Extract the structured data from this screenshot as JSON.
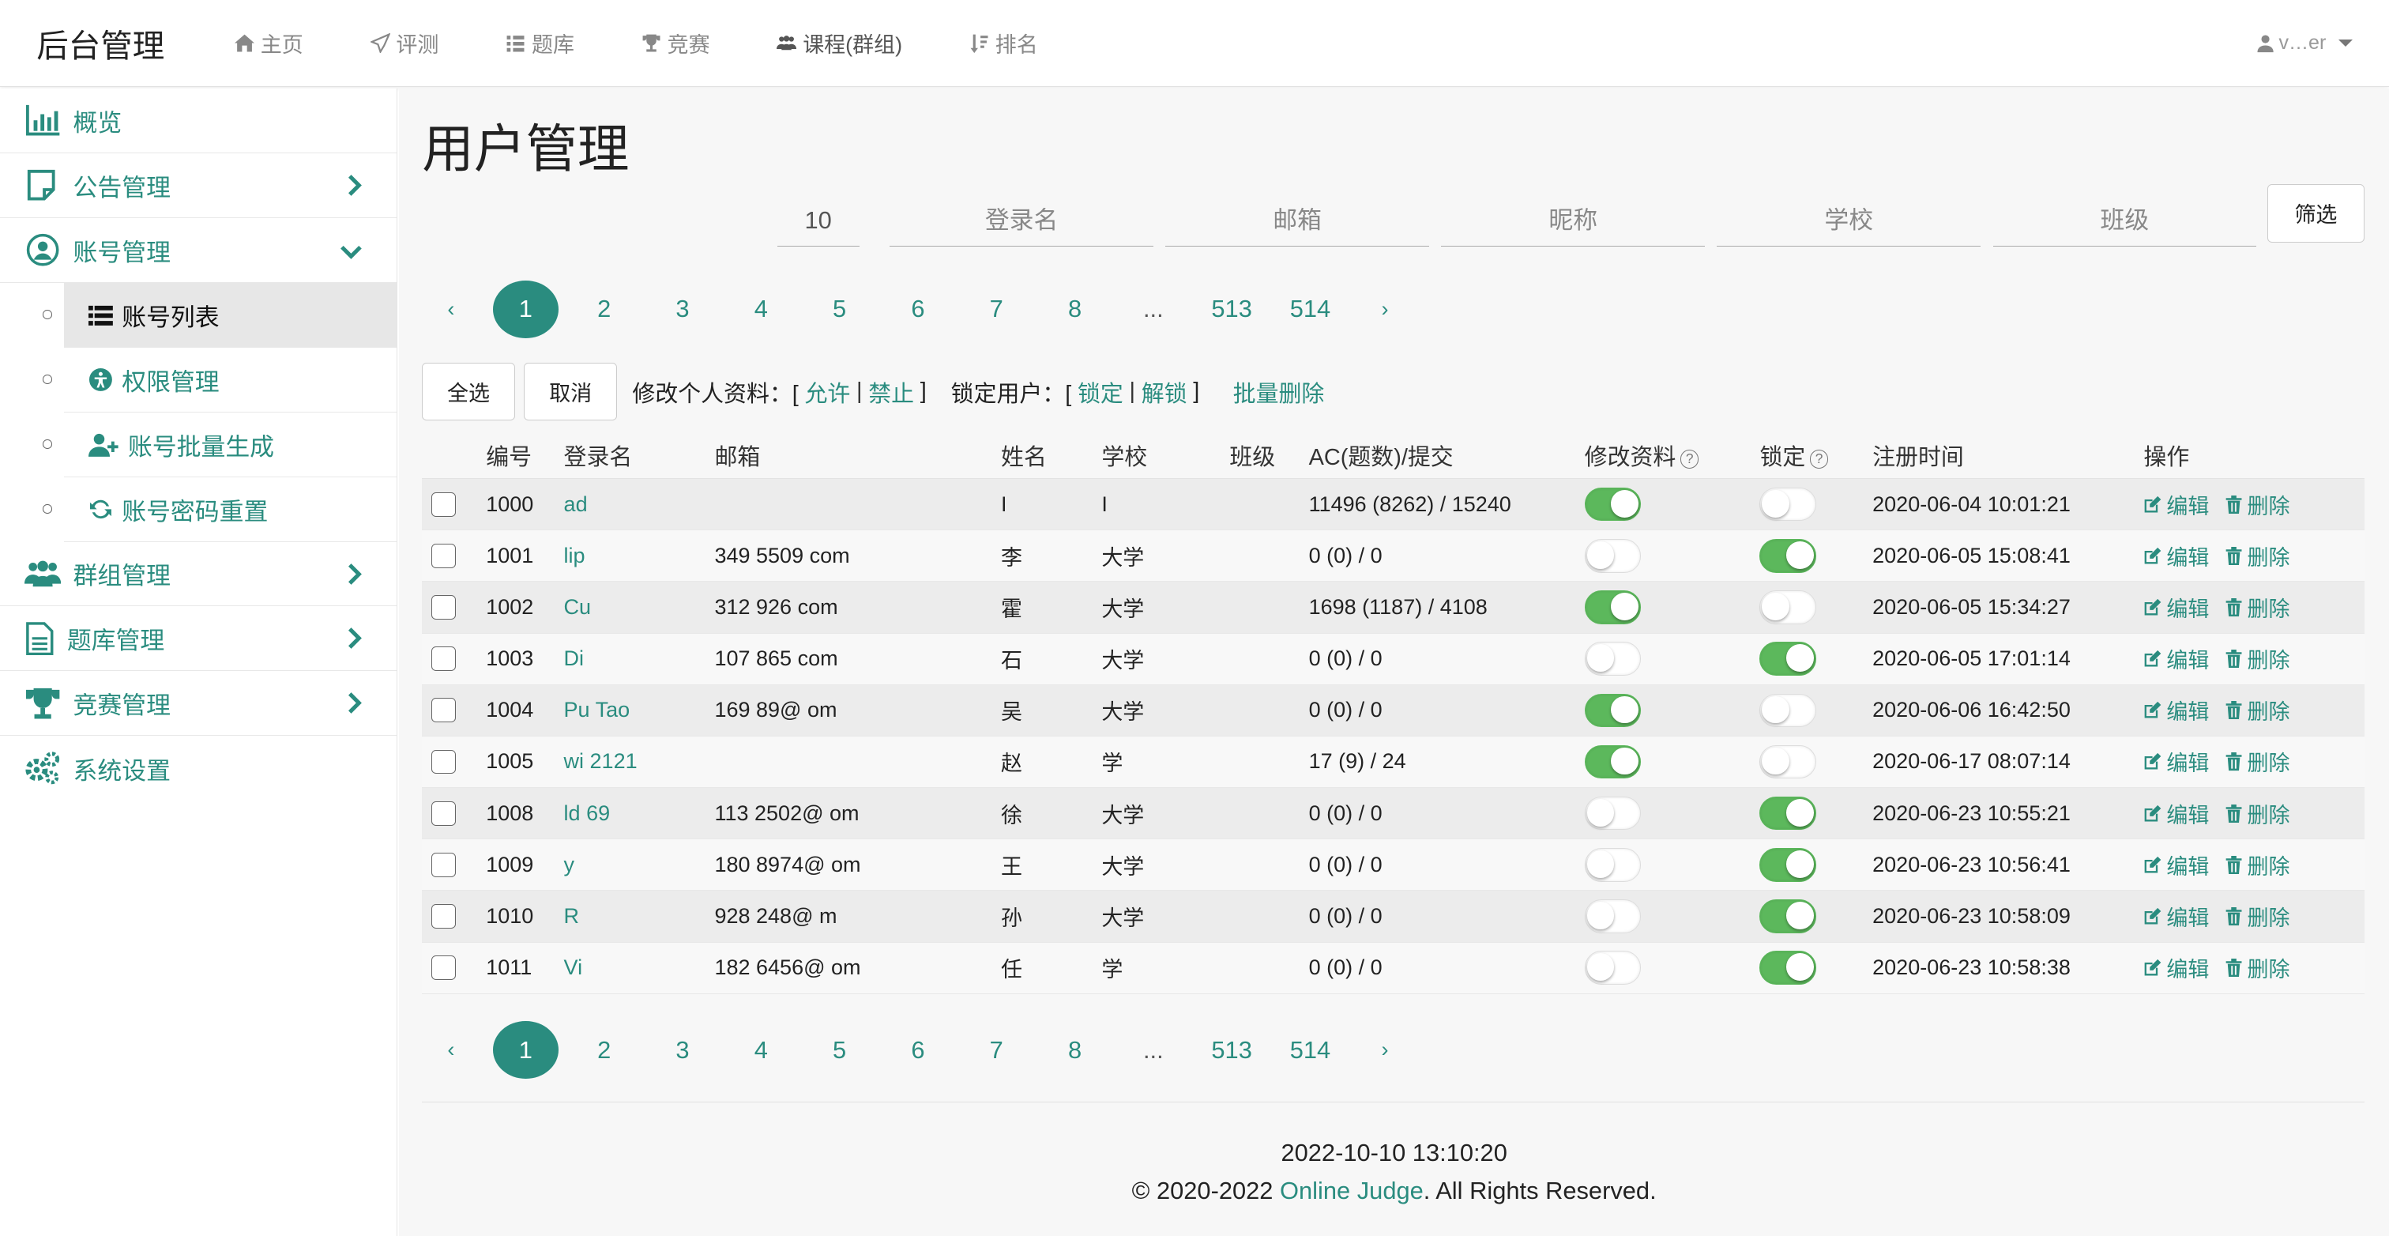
{
  "brand": "后台管理",
  "nav": [
    {
      "label": "主页",
      "icon": "home-icon"
    },
    {
      "label": "评测",
      "icon": "paper-plane-icon"
    },
    {
      "label": "题库",
      "icon": "list-icon"
    },
    {
      "label": "竞赛",
      "icon": "trophy-icon"
    },
    {
      "label": "课程(群组)",
      "icon": "users-icon"
    },
    {
      "label": "排名",
      "icon": "sort-icon"
    }
  ],
  "user_menu": {
    "icon": "user-icon",
    "name": "v…er"
  },
  "sidebar": {
    "overview": "概览",
    "notice": "公告管理",
    "account": "账号管理",
    "sub": {
      "list": "账号列表",
      "perm": "权限管理",
      "batch": "账号批量生成",
      "reset": "账号密码重置"
    },
    "group": "群组管理",
    "problem": "题库管理",
    "contest": "竞赛管理",
    "settings": "系统设置"
  },
  "page_title": "用户管理",
  "filters": {
    "page_size": "10",
    "login": "登录名",
    "email": "邮箱",
    "nickname": "昵称",
    "school": "学校",
    "class": "班级",
    "button": "筛选"
  },
  "pagination": {
    "prev": "‹",
    "next": "›",
    "pages": [
      "1",
      "2",
      "3",
      "4",
      "5",
      "6",
      "7",
      "8",
      "...",
      "513",
      "514"
    ],
    "active": "1"
  },
  "actions": {
    "select_all": "全选",
    "cancel": "取消",
    "profile_label": "修改个人资料：[",
    "allow": "允许",
    "forbid": "禁止",
    "close1": "]",
    "lock_label": "锁定用户：[",
    "lock": "锁定",
    "unlock": "解锁",
    "close2": "]",
    "bulk_delete": "批量删除",
    "bar": "|"
  },
  "table": {
    "headers": {
      "id": "编号",
      "login": "登录名",
      "email": "邮箱",
      "name": "姓名",
      "school": "学校",
      "class": "班级",
      "ac": "AC(题数)/提交",
      "edit_profile": "修改资料",
      "locked": "锁定",
      "reg_time": "注册时间",
      "ops": "操作"
    },
    "op_edit": "编辑",
    "op_delete": "删除",
    "rows": [
      {
        "id": "1000",
        "login": "ad",
        "email": "",
        "name": "I",
        "school": "I",
        "ac": "11496 (8262) / 15240",
        "edit": true,
        "lock": false,
        "time": "2020-06-04 10:01:21"
      },
      {
        "id": "1001",
        "login": "lip",
        "email": "349 5509 com",
        "name": "李",
        "school": "大学",
        "ac": "0 (0) / 0",
        "edit": false,
        "lock": true,
        "time": "2020-06-05 15:08:41"
      },
      {
        "id": "1002",
        "login": "Cu",
        "email": "312 926 com",
        "name": "霍",
        "school": "大学",
        "ac": "1698 (1187) / 4108",
        "edit": true,
        "lock": false,
        "time": "2020-06-05 15:34:27"
      },
      {
        "id": "1003",
        "login": "Di",
        "email": "107 865 com",
        "name": "石",
        "school": "大学",
        "ac": "0 (0) / 0",
        "edit": false,
        "lock": true,
        "time": "2020-06-05 17:01:14"
      },
      {
        "id": "1004",
        "login": "Pu   Tao",
        "email": "169 89@ om",
        "name": "吴",
        "school": "大学",
        "ac": "0 (0) / 0",
        "edit": true,
        "lock": false,
        "time": "2020-06-06 16:42:50"
      },
      {
        "id": "1005",
        "login": "wi   2121",
        "email": "",
        "name": "赵",
        "school": "学",
        "ac": "17 (9) / 24",
        "edit": true,
        "lock": false,
        "time": "2020-06-17 08:07:14"
      },
      {
        "id": "1008",
        "login": "ld   69",
        "email": "113 2502@ om",
        "name": "徐",
        "school": "大学",
        "ac": "0 (0) / 0",
        "edit": false,
        "lock": true,
        "time": "2020-06-23 10:55:21"
      },
      {
        "id": "1009",
        "login": "y",
        "email": "180 8974@ om",
        "name": "王",
        "school": "大学",
        "ac": "0 (0) / 0",
        "edit": false,
        "lock": true,
        "time": "2020-06-23 10:56:41"
      },
      {
        "id": "1010",
        "login": "R",
        "email": "928 248@ m",
        "name": "孙",
        "school": "大学",
        "ac": "0 (0) / 0",
        "edit": false,
        "lock": true,
        "time": "2020-06-23 10:58:09"
      },
      {
        "id": "1011",
        "login": "Vi",
        "email": "182 6456@ om",
        "name": "任",
        "school": "学",
        "ac": "0 (0) / 0",
        "edit": false,
        "lock": true,
        "time": "2020-06-23 10:58:38"
      }
    ]
  },
  "footer": {
    "datetime": "2022-10-10 13:10:20",
    "copyright_prefix": "© 2020-2022 ",
    "link": "Online Judge",
    "copyright_suffix": ". All Rights Reserved."
  },
  "colors": {
    "accent": "#2a8c7f",
    "toggle_on": "#5cb85c"
  }
}
